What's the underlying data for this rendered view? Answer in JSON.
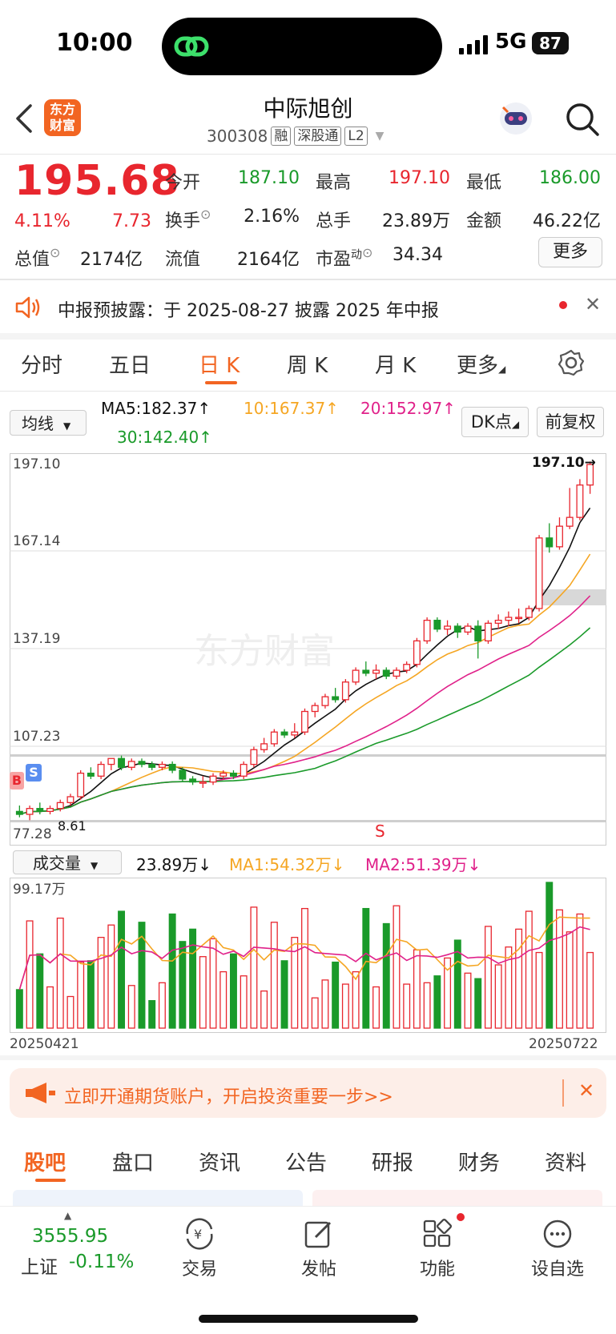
{
  "status_bar": {
    "time": "10:00",
    "network": "5G",
    "battery": "87"
  },
  "header": {
    "logo_line1": "东方",
    "logo_line2": "财富",
    "stock_name": "中际旭创",
    "stock_code": "300308",
    "tags": [
      "融",
      "深股通",
      "L2"
    ]
  },
  "quote": {
    "price": "195.68",
    "change_pct": "4.11%",
    "change_val": "7.73",
    "open_label": "今开",
    "open": "187.10",
    "high_label": "最高",
    "high": "197.10",
    "low_label": "最低",
    "low": "186.00",
    "turnover_label": "换手",
    "turnover": "2.16%",
    "volume_label": "总手",
    "volume": "23.89万",
    "amount_label": "金额",
    "amount": "46.22亿",
    "mktcap_label": "总值",
    "mktcap": "2174亿",
    "float_label": "流值",
    "float_cap": "2164亿",
    "pe_label": "市盈",
    "pe_sup": "动",
    "pe": "34.34",
    "more_button": "更多"
  },
  "notice": {
    "text": "中报预披露：于 2025-08-27 披露 2025 年中报"
  },
  "tabs": [
    "分时",
    "五日",
    "日 K",
    "周 K",
    "月 K",
    "更多"
  ],
  "ma_bar": {
    "select": "均线",
    "ma5": "MA5:182.37↑",
    "ma10": "10:167.37↑",
    "ma20": "20:152.97↑",
    "ma30": "30:142.40↑",
    "dk_button": "DK点",
    "adjust_button": "前复权"
  },
  "kline": {
    "y_labels": [
      "197.10",
      "167.14",
      "137.19",
      "107.23",
      "77.28"
    ],
    "high_marker": "197.10→",
    "low_marker": "8.61",
    "badge_b": "B",
    "badge_s": "S",
    "signal_s": "S",
    "watermark": "东方财富"
  },
  "volume": {
    "select": "成交量",
    "value": "23.89万↓",
    "ma1": "MA1:54.32万↓",
    "ma2": "MA2:51.39万↓",
    "max_label": "99.17万",
    "start_date": "20250421",
    "end_date": "20250722"
  },
  "ad": {
    "text": "立即开通期货账户，开启投资重要一步>>"
  },
  "bottom_tabs": [
    "股吧",
    "盘口",
    "资讯",
    "公告",
    "研报",
    "财务",
    "资料"
  ],
  "bottom_bar": {
    "index_value": "3555.95",
    "index_name": "上证",
    "index_change": "-0.11%",
    "items": [
      "交易",
      "发帖",
      "功能",
      "设自选"
    ]
  },
  "colors": {
    "up": "#e8262e",
    "down": "#1a9a2a",
    "accent": "#f26522",
    "ma5": "#111111",
    "ma10": "#f5a623",
    "ma20": "#e0218a",
    "ma30": "#1a9a2a"
  },
  "chart_data": {
    "type": "candlestick",
    "x_range": [
      "20250421",
      "20250722"
    ],
    "ylim": [
      77.28,
      197.1
    ],
    "candles": [
      [
        78,
        80,
        76,
        77
      ],
      [
        77,
        80,
        75,
        79
      ],
      [
        79,
        81,
        77,
        78
      ],
      [
        78,
        80,
        77,
        79
      ],
      [
        79,
        82,
        78,
        81
      ],
      [
        81,
        84,
        80,
        83
      ],
      [
        83,
        92,
        82,
        91
      ],
      [
        91,
        93,
        89,
        90
      ],
      [
        90,
        95,
        89,
        94
      ],
      [
        94,
        96,
        92,
        96
      ],
      [
        96,
        97,
        92,
        93
      ],
      [
        93,
        96,
        92,
        95
      ],
      [
        95,
        96,
        93,
        94
      ],
      [
        94,
        95,
        92,
        93
      ],
      [
        93,
        95,
        92,
        94
      ],
      [
        94,
        95,
        91,
        92
      ],
      [
        92,
        93,
        88,
        89
      ],
      [
        89,
        90,
        87,
        88
      ],
      [
        88,
        90,
        86,
        88
      ],
      [
        88,
        91,
        87,
        90
      ],
      [
        90,
        92,
        89,
        91
      ],
      [
        91,
        92,
        89,
        90
      ],
      [
        90,
        95,
        89,
        94
      ],
      [
        94,
        100,
        93,
        99
      ],
      [
        99,
        103,
        98,
        101
      ],
      [
        101,
        106,
        100,
        105
      ],
      [
        105,
        106,
        103,
        104
      ],
      [
        104,
        108,
        103,
        105
      ],
      [
        105,
        113,
        104,
        112
      ],
      [
        112,
        115,
        110,
        114
      ],
      [
        114,
        118,
        113,
        117
      ],
      [
        117,
        120,
        115,
        116
      ],
      [
        116,
        123,
        115,
        122
      ],
      [
        122,
        127,
        121,
        126
      ],
      [
        126,
        129,
        124,
        125
      ],
      [
        125,
        128,
        123,
        126
      ],
      [
        126,
        127,
        123,
        124
      ],
      [
        124,
        127,
        123,
        126
      ],
      [
        126,
        129,
        125,
        128
      ],
      [
        128,
        137,
        127,
        136
      ],
      [
        136,
        144,
        135,
        143
      ],
      [
        143,
        144,
        139,
        140
      ],
      [
        140,
        143,
        138,
        141
      ],
      [
        141,
        142,
        137,
        139
      ],
      [
        139,
        142,
        138,
        141
      ],
      [
        141,
        143,
        130,
        136
      ],
      [
        136,
        143,
        135,
        142
      ],
      [
        142,
        145,
        140,
        143
      ],
      [
        143,
        146,
        141,
        144
      ],
      [
        144,
        147,
        142,
        144
      ],
      [
        144,
        148,
        143,
        147
      ],
      [
        147,
        172,
        146,
        171
      ],
      [
        171,
        176,
        166,
        168
      ],
      [
        168,
        178,
        167,
        175
      ],
      [
        175,
        188,
        174,
        178
      ],
      [
        178,
        191,
        177,
        189
      ],
      [
        189,
        197,
        186,
        196
      ]
    ]
  }
}
